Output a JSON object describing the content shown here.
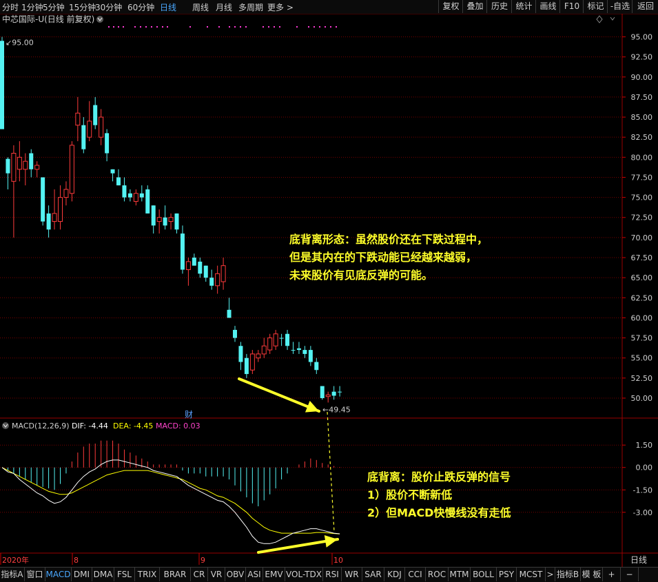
{
  "toolbar": {
    "periods": [
      {
        "label": "分时",
        "active": false
      },
      {
        "label": "1分钟",
        "active": false
      },
      {
        "label": "5分钟",
        "active": false
      },
      {
        "label": "15分钟",
        "active": false
      },
      {
        "label": "30分钟",
        "active": false
      },
      {
        "label": "60分钟",
        "active": false
      },
      {
        "label": "日线",
        "active": true
      },
      {
        "label": "周线",
        "active": false
      },
      {
        "label": "月线",
        "active": false
      },
      {
        "label": "多周期",
        "active": false
      },
      {
        "label": "更多 >",
        "active": false
      }
    ],
    "right_buttons": [
      "复权",
      "叠加",
      "历史",
      "统计",
      "画线",
      "F10",
      "标记",
      "-自选",
      "返回"
    ]
  },
  "chart_data": {
    "type": "candlestick",
    "title": "中芯国际-U(日线 前复权)",
    "y_axis_ticks": [
      "95.00",
      "92.50",
      "90.00",
      "87.50",
      "85.00",
      "82.50",
      "80.00",
      "77.50",
      "75.00",
      "72.50",
      "70.00",
      "67.50",
      "65.00",
      "62.50",
      "60.00",
      "57.50",
      "55.00",
      "52.50",
      "50.00"
    ],
    "ylim": [
      48.8,
      96.5
    ],
    "price_high_label": "95.00",
    "price_low_label": "49.45",
    "finance_marker": "财",
    "x_axis_labels": [
      "2020年",
      "8",
      "9",
      "10"
    ],
    "x_axis_right_label": "日线",
    "candles": [
      {
        "o": 94.5,
        "h": 95.0,
        "l": 84.0,
        "c": 83.5
      },
      {
        "o": 79.8,
        "h": 80.0,
        "l": 76.0,
        "c": 78.0
      },
      {
        "o": 77.0,
        "h": 81.5,
        "l": 70.0,
        "c": 80.5
      },
      {
        "o": 78.5,
        "h": 82.0,
        "l": 77.0,
        "c": 80.0
      },
      {
        "o": 78.5,
        "h": 80.5,
        "l": 76.5,
        "c": 79.5
      },
      {
        "o": 80.5,
        "h": 81.0,
        "l": 77.5,
        "c": 78.5
      },
      {
        "o": 78.5,
        "h": 79.5,
        "l": 77.5,
        "c": 79.0
      },
      {
        "o": 77.5,
        "h": 77.5,
        "l": 71.5,
        "c": 72.0
      },
      {
        "o": 73.0,
        "h": 74.0,
        "l": 70.0,
        "c": 71.0
      },
      {
        "o": 72.0,
        "h": 76.0,
        "l": 71.0,
        "c": 73.0
      },
      {
        "o": 72.0,
        "h": 76.5,
        "l": 71.0,
        "c": 75.0
      },
      {
        "o": 75.0,
        "h": 77.0,
        "l": 74.0,
        "c": 76.0
      },
      {
        "o": 75.5,
        "h": 82.0,
        "l": 74.5,
        "c": 81.5
      },
      {
        "o": 84.0,
        "h": 87.5,
        "l": 82.0,
        "c": 85.5
      },
      {
        "o": 84.0,
        "h": 85.0,
        "l": 80.5,
        "c": 81.0
      },
      {
        "o": 82.5,
        "h": 87.0,
        "l": 82.0,
        "c": 84.5
      },
      {
        "o": 86.5,
        "h": 87.5,
        "l": 83.5,
        "c": 84.0
      },
      {
        "o": 82.5,
        "h": 86.0,
        "l": 81.5,
        "c": 85.0
      },
      {
        "o": 83.0,
        "h": 83.5,
        "l": 79.5,
        "c": 80.5
      },
      {
        "o": 78.5,
        "h": 78.5,
        "l": 77.0,
        "c": 78.0
      },
      {
        "o": 77.5,
        "h": 78.5,
        "l": 76.5,
        "c": 76.5
      },
      {
        "o": 76.5,
        "h": 77.5,
        "l": 74.5,
        "c": 75.0
      },
      {
        "o": 75.5,
        "h": 76.0,
        "l": 74.5,
        "c": 75.0
      },
      {
        "o": 74.5,
        "h": 76.0,
        "l": 74.0,
        "c": 75.5
      },
      {
        "o": 75.5,
        "h": 76.5,
        "l": 74.5,
        "c": 75.0
      },
      {
        "o": 76.0,
        "h": 76.5,
        "l": 73.0,
        "c": 73.0
      },
      {
        "o": 74.0,
        "h": 74.0,
        "l": 70.5,
        "c": 71.5
      },
      {
        "o": 72.0,
        "h": 73.5,
        "l": 70.5,
        "c": 72.5
      },
      {
        "o": 72.5,
        "h": 74.0,
        "l": 71.0,
        "c": 71.5
      },
      {
        "o": 72.0,
        "h": 73.0,
        "l": 71.0,
        "c": 72.5
      },
      {
        "o": 73.0,
        "h": 73.0,
        "l": 70.5,
        "c": 71.0
      },
      {
        "o": 70.5,
        "h": 71.5,
        "l": 65.5,
        "c": 66.0
      },
      {
        "o": 66.0,
        "h": 67.5,
        "l": 64.0,
        "c": 67.0
      },
      {
        "o": 67.5,
        "h": 68.0,
        "l": 66.5,
        "c": 66.5
      },
      {
        "o": 67.0,
        "h": 67.5,
        "l": 65.0,
        "c": 65.5
      },
      {
        "o": 66.5,
        "h": 66.5,
        "l": 64.5,
        "c": 65.0
      },
      {
        "o": 65.0,
        "h": 66.0,
        "l": 63.5,
        "c": 64.0
      },
      {
        "o": 64.0,
        "h": 66.5,
        "l": 63.0,
        "c": 65.5
      },
      {
        "o": 64.5,
        "h": 67.5,
        "l": 63.5,
        "c": 66.5
      },
      {
        "o": 61.0,
        "h": 62.5,
        "l": 60.0,
        "c": 60.0
      },
      {
        "o": 58.5,
        "h": 59.0,
        "l": 57.0,
        "c": 57.5
      },
      {
        "o": 56.5,
        "h": 57.0,
        "l": 53.5,
        "c": 54.5
      },
      {
        "o": 55.0,
        "h": 55.5,
        "l": 52.5,
        "c": 53.0
      },
      {
        "o": 53.5,
        "h": 56.0,
        "l": 53.0,
        "c": 55.5
      },
      {
        "o": 55.0,
        "h": 56.0,
        "l": 54.5,
        "c": 55.5
      },
      {
        "o": 55.5,
        "h": 57.5,
        "l": 55.0,
        "c": 56.5
      },
      {
        "o": 56.0,
        "h": 58.0,
        "l": 55.5,
        "c": 57.5
      },
      {
        "o": 56.5,
        "h": 58.5,
        "l": 56.0,
        "c": 58.0
      },
      {
        "o": 57.5,
        "h": 58.0,
        "l": 56.5,
        "c": 57.5
      },
      {
        "o": 58.0,
        "h": 58.5,
        "l": 56.0,
        "c": 56.5
      },
      {
        "o": 56.0,
        "h": 57.0,
        "l": 55.5,
        "c": 56.0
      },
      {
        "o": 56.2,
        "h": 57.0,
        "l": 55.5,
        "c": 56.0
      },
      {
        "o": 56.0,
        "h": 56.5,
        "l": 55.0,
        "c": 55.5
      },
      {
        "o": 56.0,
        "h": 56.5,
        "l": 54.0,
        "c": 54.5
      },
      {
        "o": 54.5,
        "h": 55.0,
        "l": 53.0,
        "c": 53.5
      },
      {
        "o": 51.5,
        "h": 51.5,
        "l": 49.8,
        "c": 50.0
      },
      {
        "o": 50.2,
        "h": 50.8,
        "l": 49.45,
        "c": 50.4
      },
      {
        "o": 50.8,
        "h": 51.5,
        "l": 49.8,
        "c": 50.3
      },
      {
        "o": 50.8,
        "h": 51.5,
        "l": 50.2,
        "c": 50.8
      }
    ],
    "macd": {
      "label_title": "MACD(12,26,9)",
      "dif_label": "DIF: -4.44",
      "dea_label": "DEA: -4.45",
      "macd_label": "MACD: 0.03",
      "y_axis_ticks": [
        "1.50",
        "0.00",
        "-1.50",
        "-3.00"
      ],
      "ylim": [
        -5.5,
        2.8
      ],
      "dif": [
        0.0,
        -0.3,
        -0.4,
        -0.8,
        -1.1,
        -1.4,
        -1.7,
        -1.9,
        -2.2,
        -2.4,
        -2.3,
        -2.0,
        -1.5,
        -1.0,
        -0.6,
        -0.3,
        -0.1,
        0.2,
        0.4,
        0.5,
        0.5,
        0.4,
        0.3,
        0.2,
        0.1,
        0.0,
        -0.2,
        -0.3,
        -0.4,
        -0.5,
        -0.6,
        -0.9,
        -1.2,
        -1.4,
        -1.6,
        -1.8,
        -2.0,
        -2.2,
        -2.3,
        -2.6,
        -3.0,
        -3.5,
        -4.0,
        -4.6,
        -5.0,
        -5.1,
        -5.1,
        -5.0,
        -4.8,
        -4.6,
        -4.4,
        -4.3,
        -4.2,
        -4.1,
        -4.1,
        -4.2,
        -4.3,
        -4.4,
        -4.44
      ],
      "dea": [
        0.0,
        -0.2,
        -0.4,
        -0.6,
        -0.8,
        -1.0,
        -1.2,
        -1.4,
        -1.6,
        -1.7,
        -1.8,
        -1.8,
        -1.7,
        -1.5,
        -1.3,
        -1.1,
        -0.9,
        -0.7,
        -0.5,
        -0.4,
        -0.3,
        -0.2,
        -0.2,
        -0.2,
        -0.2,
        -0.2,
        -0.3,
        -0.4,
        -0.5,
        -0.6,
        -0.7,
        -0.8,
        -1.0,
        -1.2,
        -1.4,
        -1.5,
        -1.7,
        -1.9,
        -2.0,
        -2.2,
        -2.4,
        -2.7,
        -3.0,
        -3.4,
        -3.7,
        -4.0,
        -4.2,
        -4.3,
        -4.4,
        -4.4,
        -4.4,
        -4.4,
        -4.4,
        -4.4,
        -4.35,
        -4.35,
        -4.38,
        -4.42,
        -4.45
      ],
      "histogram": [
        0.0,
        -0.2,
        -0.4,
        -0.6,
        -0.8,
        -1.0,
        -1.2,
        -1.3,
        -1.4,
        -1.5,
        -1.1,
        -0.4,
        0.4,
        1.0,
        1.4,
        1.6,
        1.6,
        1.8,
        1.8,
        1.8,
        1.6,
        1.2,
        1.0,
        0.8,
        0.6,
        0.4,
        0.2,
        0.2,
        0.2,
        0.2,
        0.2,
        -0.2,
        -0.4,
        -0.4,
        -0.4,
        -0.6,
        -0.6,
        -0.6,
        -0.6,
        -0.8,
        -1.2,
        -1.6,
        -2.0,
        -2.4,
        -2.6,
        -2.2,
        -1.8,
        -1.4,
        -0.8,
        -0.4,
        0.0,
        0.2,
        0.4,
        0.6,
        0.5,
        0.3,
        0.2,
        0.1,
        0.03
      ]
    }
  },
  "annotations": {
    "top": [
      "底背离形态：虽然股价还在下跌过程中，",
      "但是其内在的下跌动能已经越来越弱，",
      "未来股价有见底反弹的可能。"
    ],
    "bottom": [
      "底背离：股价止跌反弹的信号",
      "1）股价不断新低",
      "2）但MACD快慢线没有走低"
    ]
  },
  "indicator_tabs": [
    "指标A",
    "窗口",
    "MACD",
    "DMI",
    "DMA",
    "FSL",
    "TRIX",
    "BRAR",
    "CR",
    "VR",
    "OBV",
    "ASI",
    "EMV",
    "VOL-TDX",
    "RSI",
    "WR",
    "SAR",
    "KDJ",
    "CCI",
    "ROC",
    "MTM",
    "BOLL",
    "PSY",
    "MCST",
    ">",
    "指标B",
    "模 板",
    "+",
    "−"
  ],
  "active_indicator": "MACD",
  "colors": {
    "up": "#ff3b3b",
    "down": "#54f2f2",
    "grid": "#7a0000",
    "dif": "#ffffff",
    "dea": "#ffff00",
    "annotation": "#ffff2a",
    "active_tab": "#4aa8ff",
    "magenta": "#ff3bd6"
  }
}
